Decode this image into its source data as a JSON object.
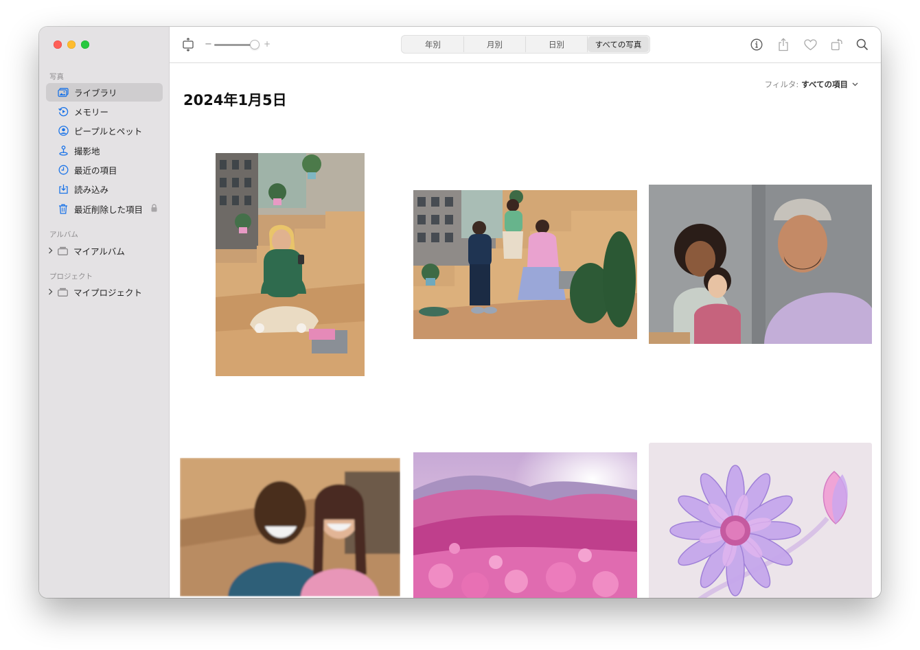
{
  "sidebar": {
    "sections": {
      "photos": "写真",
      "albums": "アルバム",
      "projects": "プロジェクト"
    },
    "items": [
      {
        "label": "ライブラリ",
        "icon": "library-icon",
        "active": true
      },
      {
        "label": "メモリー",
        "icon": "memories-icon"
      },
      {
        "label": "ピープルとペット",
        "icon": "people-icon"
      },
      {
        "label": "撮影地",
        "icon": "places-icon"
      },
      {
        "label": "最近の項目",
        "icon": "recents-icon"
      },
      {
        "label": "読み込み",
        "icon": "imports-icon"
      },
      {
        "label": "最近削除した項目",
        "icon": "trash-icon",
        "locked": true
      }
    ],
    "albums": [
      {
        "label": "マイアルバム",
        "icon": "album-folder-icon"
      }
    ],
    "projects": [
      {
        "label": "マイプロジェクト",
        "icon": "project-folder-icon"
      }
    ]
  },
  "toolbar": {
    "zoom_minus": "−",
    "zoom_plus": "+",
    "zoom_level": 0.85,
    "tabs": [
      "年別",
      "月別",
      "日別",
      "すべての写真"
    ],
    "active_tab": "すべての写真",
    "icons": [
      "info-icon",
      "share-icon",
      "heart-icon",
      "rotate-icon",
      "search-icon"
    ]
  },
  "main": {
    "date_heading": "2024年1月5日",
    "filter_label": "フィルタ:",
    "filter_value": "すべての項目"
  },
  "colors": {
    "accent": "#1a73e8",
    "sidebar_bg": "#e4e2e4",
    "active_row": "#cfcdcf"
  }
}
